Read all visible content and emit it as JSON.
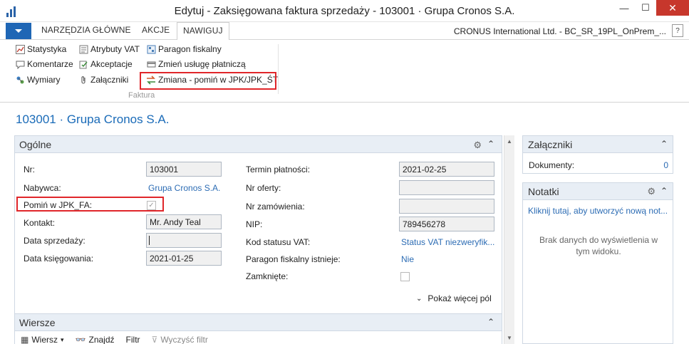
{
  "window": {
    "title": "Edytuj - Zaksięgowana faktura sprzedaży - 103001 · Grupa Cronos S.A.",
    "minimize": "—",
    "maximize": "☐",
    "close": "✕"
  },
  "ribbon_tabs": [
    {
      "label": "NARZĘDZIA GŁÓWNE"
    },
    {
      "label": "AKCJE"
    },
    {
      "label": "NAWIGUJ",
      "active": true
    }
  ],
  "company": "CRONUS International Ltd. - BC_SR_19PL_OnPrem_...",
  "help": "?",
  "ribbon": {
    "col1": [
      {
        "label": "Statystyka",
        "icon": "statistics-icon"
      },
      {
        "label": "Komentarze",
        "icon": "comments-icon"
      },
      {
        "label": "Wymiary",
        "icon": "dimensions-icon"
      }
    ],
    "col2": [
      {
        "label": "Atrybuty VAT",
        "icon": "vat-attributes-icon"
      },
      {
        "label": "Akceptacje",
        "icon": "approvals-icon"
      },
      {
        "label": "Załączniki",
        "icon": "paperclip-icon"
      }
    ],
    "col3": [
      {
        "label": "Paragon fiskalny",
        "icon": "fiscal-receipt-icon"
      },
      {
        "label": "Zmień usługę płatniczą",
        "icon": "payment-service-icon"
      },
      {
        "label": "Zmiana - pomiń w JPK/JPK_ŚT",
        "icon": "swap-arrows-icon"
      }
    ],
    "group_label": "Faktura"
  },
  "page_title": "103001 · Grupa Cronos S.A.",
  "general": {
    "title": "Ogólne",
    "left": {
      "nr_label": "Nr:",
      "nr_value": "103001",
      "nabywca_label": "Nabywca:",
      "nabywca_value": "Grupa Cronos S.A.",
      "pomin_label": "Pomiń w JPK_FA:",
      "pomin_checked": true,
      "kontakt_label": "Kontakt:",
      "kontakt_value": "Mr. Andy Teal",
      "data_sprzedazy_label": "Data sprzedaży:",
      "data_sprzedazy_value": "",
      "data_ksiegowania_label": "Data księgowania:",
      "data_ksiegowania_value": "2021-01-25"
    },
    "right": {
      "termin_label": "Termin płatności:",
      "termin_value": "2021-02-25",
      "nr_oferty_label": "Nr oferty:",
      "nr_oferty_value": "",
      "nr_zamowienia_label": "Nr zamówienia:",
      "nr_zamowienia_value": "",
      "nip_label": "NIP:",
      "nip_value": "789456278",
      "kod_vat_label": "Kod statusu VAT:",
      "kod_vat_value": "Status VAT niezweryfik...",
      "paragon_label": "Paragon fiskalny istnieje:",
      "paragon_value": "Nie",
      "zamkniete_label": "Zamknięte:",
      "zamkniete_checked": false
    },
    "show_more": "Pokaż więcej pól"
  },
  "lines": {
    "title": "Wiersze",
    "tools": [
      {
        "label": "Wiersz",
        "icon": "grid-icon",
        "dropdown": "▾"
      },
      {
        "label": "Znajdź",
        "icon": "binoculars-icon"
      },
      {
        "label": "Filtr",
        "icon": ""
      },
      {
        "label": "Wyczyść filtr",
        "icon": "clear-filter-icon"
      }
    ]
  },
  "factboxes": {
    "attachments": {
      "title": "Załączniki",
      "documents_label": "Dokumenty:",
      "documents_value": "0"
    },
    "notes": {
      "title": "Notatki",
      "create_link": "Kliknij tutaj, aby utworzyć nową not...",
      "empty_text": "Brak danych do wyświetlenia w tym widoku."
    }
  },
  "colors": {
    "accent": "#1a6bb8",
    "link": "#2c6cb4",
    "highlight": "#e0262a",
    "file_button": "#1f66b5",
    "section_header": "#e8eef5"
  }
}
